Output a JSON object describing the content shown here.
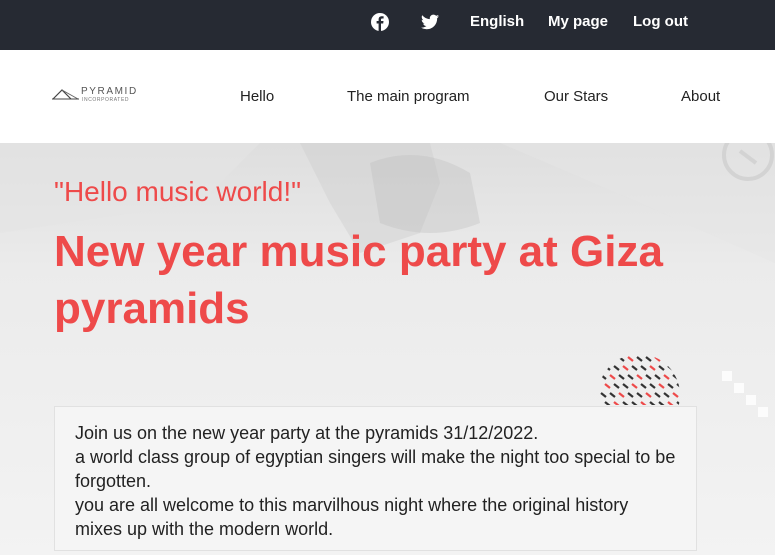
{
  "topbar": {
    "facebook_icon": "facebook-icon",
    "twitter_icon": "twitter-icon",
    "language": "English",
    "my_page": "My page",
    "logout": "Log out"
  },
  "logo": {
    "brand": "PYRAMID",
    "sub": "INCORPORATED"
  },
  "nav": {
    "items": [
      "Hello",
      "The main program",
      "Our Stars",
      "About"
    ]
  },
  "hero": {
    "quote": "\"Hello music world!\"",
    "title": "New year music party at Giza pyramids",
    "description": [
      "Join us on the new year party at the pyramids 31/12/2022.",
      "a world class group of egyptian singers will make the night too special to be forgotten.",
      "you are all welcome to this marvilhous night where the original history mixes up with the modern world."
    ]
  },
  "colors": {
    "accent": "#ee4a4a",
    "topbar_bg": "#262a33",
    "nav_bg": "#ffffff"
  }
}
